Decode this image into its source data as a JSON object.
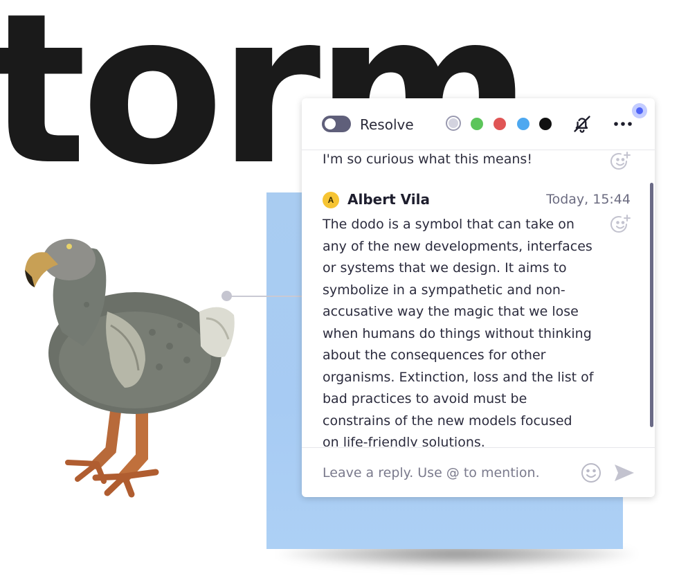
{
  "canvas": {
    "heading_text": "torm"
  },
  "comment_panel": {
    "resolve_label": "Resolve",
    "colors": [
      {
        "name": "gray",
        "hex": "#d3d3df",
        "selected": true
      },
      {
        "name": "green",
        "hex": "#5cc55a",
        "selected": false
      },
      {
        "name": "red",
        "hex": "#e05555",
        "selected": false
      },
      {
        "name": "blue",
        "hex": "#4da8f0",
        "selected": false
      },
      {
        "name": "black",
        "hex": "#111111",
        "selected": false
      }
    ],
    "icons": {
      "mute": "bell-off-icon",
      "more": "more-horizontal-icon",
      "reaction": "add-reaction-icon",
      "emoji": "emoji-icon",
      "send": "send-icon"
    },
    "previous_message": "I'm so curious what this means!",
    "comment": {
      "author_initial": "A",
      "author_name": "Albert Vila",
      "timestamp": "Today, 15:44",
      "lines": [
        "The dodo is a symbol that can take on",
        "any of the new developments, interfaces",
        "or systems that we design. It aims to",
        "symbolize in a sympathetic and non-",
        "accusative way the magic that we lose",
        "when humans do things without thinking",
        "about the consequences for other",
        "organisms. Extinction, loss and the list of",
        "bad practices to avoid must be",
        "constrains of the new models focused",
        "on life-friendly solutions."
      ]
    },
    "reply": {
      "placeholder": "Leave a reply. Use @ to mention."
    }
  },
  "accent_colors": {
    "notification": "#4f64f7",
    "sticky_note": "#a8ccf2",
    "avatar": "#f6c433"
  }
}
